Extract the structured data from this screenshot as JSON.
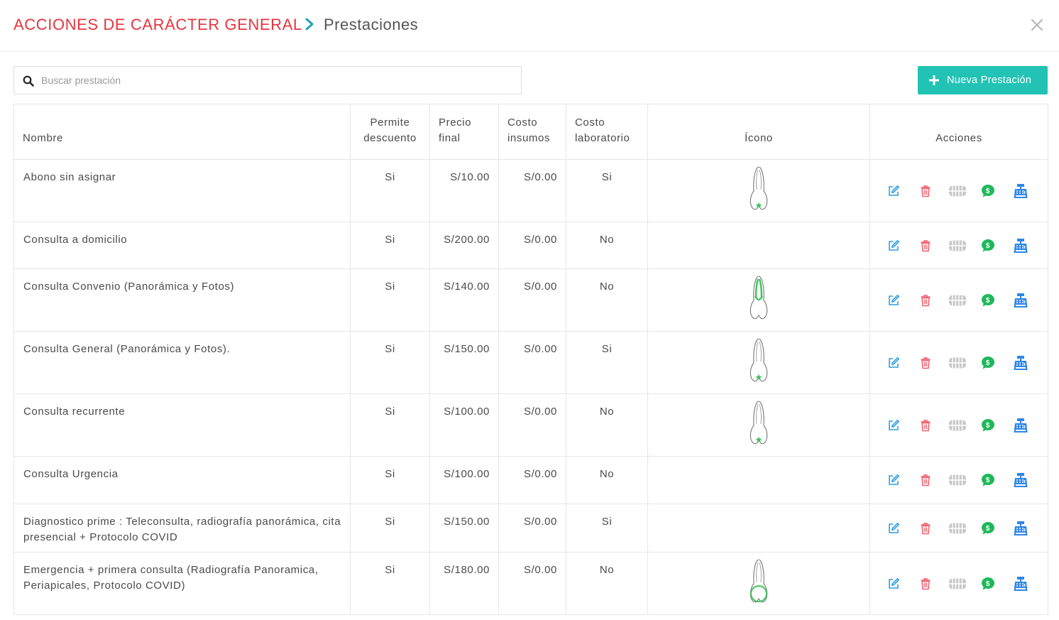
{
  "header": {
    "title": "ACCIONES DE CARÁCTER GENERAL",
    "subtitle": "Prestaciones"
  },
  "search": {
    "placeholder": "Buscar prestación",
    "value": ""
  },
  "toolbar": {
    "new_label": "Nueva Prestación"
  },
  "table": {
    "headers": {
      "nombre": "Nombre",
      "descuento_1": "Permite",
      "descuento_2": "descuento",
      "precio_1": "Precio",
      "precio_2": "final",
      "insumos_1": "Costo",
      "insumos_2": "insumos",
      "lab_1": "Costo",
      "lab_2": "laboratorio",
      "icono": "Ícono",
      "acciones": "Acciones"
    },
    "rows": [
      {
        "name": "Abono sin asignar",
        "discount": "Si",
        "price": "S/10.00",
        "supplies": "S/0.00",
        "lab": "Si",
        "tooth": "star"
      },
      {
        "name": "Consulta a domicilio",
        "discount": "Si",
        "price": "S/200.00",
        "supplies": "S/0.00",
        "lab": "No",
        "tooth": "none"
      },
      {
        "name": "Consulta Convenio (Panorámica y Fotos)",
        "discount": "Si",
        "price": "S/140.00",
        "supplies": "S/0.00",
        "lab": "No",
        "tooth": "root"
      },
      {
        "name": "Consulta General (Panorámica y Fotos).",
        "discount": "Si",
        "price": "S/150.00",
        "supplies": "S/0.00",
        "lab": "Si",
        "tooth": "star"
      },
      {
        "name": "Consulta recurrente",
        "discount": "Si",
        "price": "S/100.00",
        "supplies": "S/0.00",
        "lab": "No",
        "tooth": "star"
      },
      {
        "name": "Consulta Urgencia",
        "discount": "Si",
        "price": "S/100.00",
        "supplies": "S/0.00",
        "lab": "No",
        "tooth": "none"
      },
      {
        "name": "Diagnostico prime : Teleconsulta, radiografía panorámica, cita presencial + Protocolo COVID",
        "discount": "Si",
        "price": "S/150.00",
        "supplies": "S/0.00",
        "lab": "Si",
        "tooth": "none"
      },
      {
        "name": "Emergencia + primera consulta (Radiografía Panoramica, Periapicales, Protocolo COVID)",
        "discount": "Si",
        "price": "S/180.00",
        "supplies": "S/0.00",
        "lab": "No",
        "tooth": "crown"
      }
    ]
  },
  "icons": {
    "edit": "edit-icon",
    "delete": "trash-icon",
    "teeth": "teeth-icon",
    "money": "money-chat-icon",
    "register": "cash-register-icon"
  },
  "colors": {
    "title_red": "#e8343e",
    "accent_teal": "#22c3b4",
    "chevron_teal": "#1fa3b8",
    "edit_blue": "#2f9ee0",
    "delete_red": "#ef5d6b",
    "disabled_gray": "#c8c8c8",
    "money_green": "#1eb85a",
    "register_blue": "#2e86e8",
    "tooth_green": "#3cc35a"
  }
}
